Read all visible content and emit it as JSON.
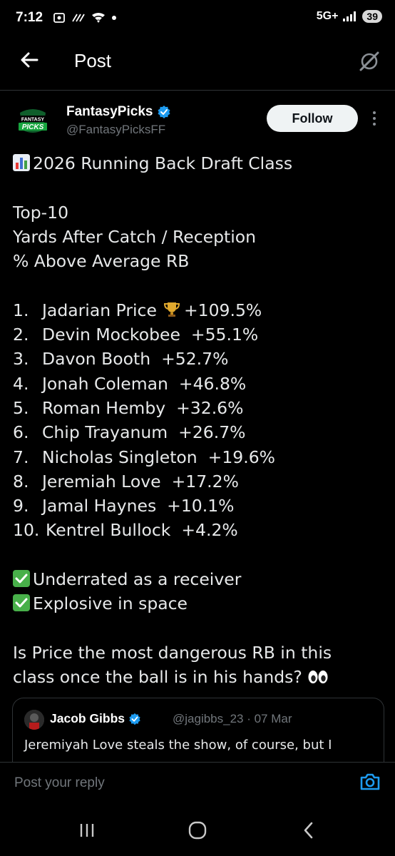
{
  "status_bar": {
    "time": "7:12",
    "network": "5G+",
    "battery": "39"
  },
  "header": {
    "title": "Post",
    "back_icon": "arrow-left-icon",
    "grok_icon": "grok-icon"
  },
  "author": {
    "name": "FantasyPicks",
    "handle": "@FantasyPicksFF",
    "verified": true,
    "avatar_text": [
      "FANTASY",
      "PICKS"
    ],
    "follow_label": "Follow"
  },
  "post": {
    "title": "2026 Running Back Draft Class",
    "subtitle_lines": [
      "Top-10",
      "Yards After Catch / Reception",
      "% Above Average RB"
    ],
    "rankings": [
      {
        "rank": "1.",
        "name": "Jadarian Price",
        "trophy": true,
        "value": "+109.5%"
      },
      {
        "rank": "2.",
        "name": "Devin Mockobee",
        "trophy": false,
        "value": "+55.1%"
      },
      {
        "rank": "3.",
        "name": "Davon Booth",
        "trophy": false,
        "value": "+52.7%"
      },
      {
        "rank": "4.",
        "name": "Jonah Coleman",
        "trophy": false,
        "value": "+46.8%"
      },
      {
        "rank": "5.",
        "name": "Roman Hemby",
        "trophy": false,
        "value": "+32.6%"
      },
      {
        "rank": "6.",
        "name": "Chip Trayanum",
        "trophy": false,
        "value": "+26.7%"
      },
      {
        "rank": "7.",
        "name": "Nicholas Singleton",
        "trophy": false,
        "value": "+19.6%"
      },
      {
        "rank": "8.",
        "name": "Jeremiah Love",
        "trophy": false,
        "value": "+17.2%"
      },
      {
        "rank": "9.",
        "name": "Jamal Haynes",
        "trophy": false,
        "value": "+10.1%"
      },
      {
        "rank": "10.",
        "name": "Kentrel Bullock",
        "trophy": false,
        "value": "+4.2%"
      }
    ],
    "checks": [
      "Underrated as a receiver",
      "Explosive in space"
    ],
    "question_lines": [
      "Is Price the most dangerous RB in this",
      "class once the ball is in his hands?"
    ]
  },
  "quote": {
    "name": "Jacob Gibbs",
    "handle": "@jagibbs_23 · 07 Mar",
    "text": "Jeremiyah Love steals the show, of course, but I"
  },
  "reply": {
    "placeholder": "Post your reply"
  },
  "colors": {
    "background": "#000000",
    "text": "#e7e9ea",
    "muted": "#71767b",
    "verified_blue": "#1d9bf0",
    "check_green": "#48b04a"
  }
}
